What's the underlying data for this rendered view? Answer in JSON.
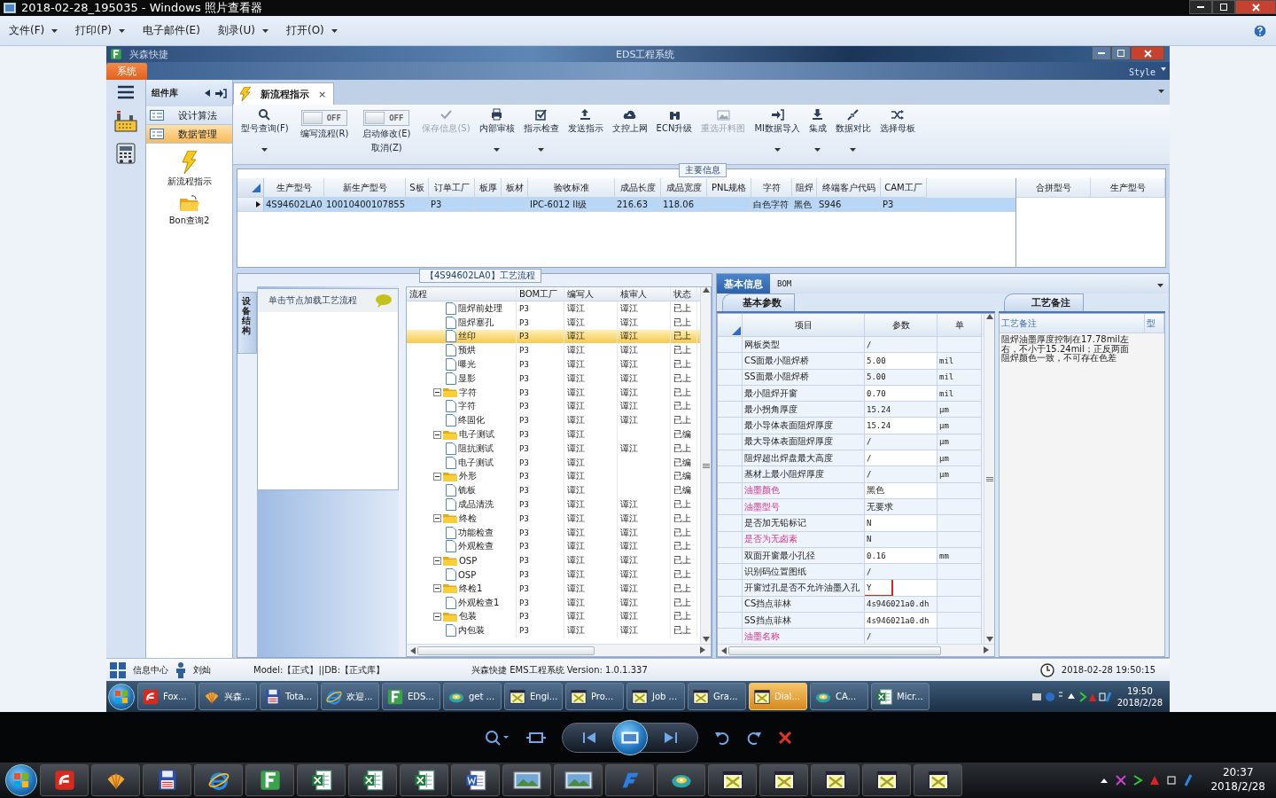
{
  "viewer": {
    "title": "2018-02-28_195035 - Windows 照片查看器",
    "menu": [
      {
        "label": "文件(F)",
        "dropdown": true
      },
      {
        "label": "打印(P)",
        "dropdown": true
      },
      {
        "label": "电子邮件(E)",
        "dropdown": false
      },
      {
        "label": "刻录(U)",
        "dropdown": true
      },
      {
        "label": "打开(O)",
        "dropdown": true
      }
    ]
  },
  "app": {
    "brand": "兴森快捷",
    "title": "EDS工程系统",
    "ribbon_tab": "系统",
    "style_label": "Style",
    "library": {
      "title": "组件库",
      "groups": [
        {
          "label": "设计算法",
          "selected": false
        },
        {
          "label": "数据管理",
          "selected": true
        }
      ],
      "tools": [
        {
          "label": "新流程指示",
          "kind": "bolt"
        },
        {
          "label": "Bon查询2",
          "kind": "folder"
        }
      ]
    },
    "doc_tab": {
      "label": "新流程指示",
      "close": "×"
    },
    "toolbar": [
      {
        "kind": "button",
        "label": "型号查询(F)",
        "dropdown": true,
        "disabled": false
      },
      {
        "kind": "toggle",
        "label": "编写流程(R)",
        "state": "OFF",
        "on": false
      },
      {
        "kind": "toggle",
        "label": "启动修改(E)",
        "label2": "取消(Z)",
        "state": "OFF",
        "on": false
      },
      {
        "kind": "button",
        "label": "保存信息(S)",
        "dropdown": false,
        "disabled": true
      },
      {
        "kind": "button",
        "label": "内部审核",
        "dropdown": true,
        "disabled": false
      },
      {
        "kind": "button",
        "label": "指示检查",
        "dropdown": true,
        "disabled": false
      },
      {
        "kind": "button",
        "label": "发送指示",
        "dropdown": false,
        "disabled": false
      },
      {
        "kind": "button",
        "label": "文控上网",
        "dropdown": false,
        "disabled": false
      },
      {
        "kind": "button",
        "label": "ECN升级",
        "dropdown": false,
        "disabled": false
      },
      {
        "kind": "button",
        "label": "重选开料图",
        "dropdown": false,
        "disabled": true
      },
      {
        "kind": "button",
        "label": "MI数据导入",
        "dropdown": true,
        "disabled": false
      },
      {
        "kind": "button",
        "label": "集成",
        "dropdown": true,
        "disabled": false
      },
      {
        "kind": "button",
        "label": "数据对比",
        "dropdown": true,
        "disabled": false
      },
      {
        "kind": "button",
        "label": "选择母板",
        "dropdown": false,
        "disabled": false
      }
    ],
    "main_info": {
      "title": "主要信息",
      "columns": [
        "生产型号",
        "新生产型号",
        "S板",
        "订单工厂",
        "板厚",
        "板材",
        "验收标准",
        "成品长度",
        "成品宽度",
        "PNL规格",
        "字符",
        "阻焊",
        "终端客户代码",
        "CAM工厂"
      ],
      "rows": [
        {
          "selected": true,
          "cells": [
            "4S94602LA0",
            "10010400107855",
            null,
            "P3",
            null,
            null,
            "IPC-6012 II级",
            "216.63",
            "118.06",
            null,
            "白色字符",
            "黑色",
            "S946",
            "P3"
          ]
        }
      ],
      "side_columns": [
        "合拼型号",
        "生产型号"
      ]
    },
    "flow": {
      "title": "【4S94602LA0】工艺流程",
      "side_tab": "设备结构",
      "hint": "单击节点加载工艺流程",
      "columns": [
        "流程",
        "BOM工厂",
        "编写人",
        "核审人",
        "状态"
      ],
      "rows": [
        {
          "kind": "continued",
          "children": [
            {
              "kind": "file",
              "label": "阻焊前处理",
              "factory": "P3",
              "author": "谭江",
              "reviewer": "谭江",
              "status": "已上",
              "selected": false
            },
            {
              "kind": "file",
              "label": "阻焊塞孔",
              "factory": "P3",
              "author": "谭江",
              "reviewer": "谭江",
              "status": "已上",
              "selected": false
            },
            {
              "kind": "file",
              "label": "丝印",
              "factory": "P3",
              "author": "谭江",
              "reviewer": "谭江",
              "status": "已上",
              "selected": true
            },
            {
              "kind": "file",
              "label": "预烘",
              "factory": "P3",
              "author": "谭江",
              "reviewer": "谭江",
              "status": "已上",
              "selected": false
            },
            {
              "kind": "file",
              "label": "曝光",
              "factory": "P3",
              "author": "谭江",
              "reviewer": "谭江",
              "status": "已上",
              "selected": false
            },
            {
              "kind": "file",
              "label": "显影",
              "factory": "P3",
              "author": "谭江",
              "reviewer": "谭江",
              "status": "已上",
              "selected": false
            }
          ]
        },
        {
          "kind": "folder",
          "label": "字符",
          "factory": "P3",
          "author": "谭江",
          "reviewer": "谭江",
          "status": "已上",
          "selected": false,
          "expanded": true,
          "children": [
            {
              "kind": "file",
              "label": "字符",
              "factory": "P3",
              "author": "谭江",
              "reviewer": "谭江",
              "status": "已上",
              "selected": false
            },
            {
              "kind": "file",
              "label": "终固化",
              "factory": "P3",
              "author": "谭江",
              "reviewer": "谭江",
              "status": "已上",
              "selected": false
            }
          ]
        },
        {
          "kind": "folder",
          "label": "电子测试",
          "factory": "P3",
          "author": "谭江",
          "status": "已编",
          "selected": false,
          "expanded": true,
          "children": [
            {
              "kind": "file",
              "label": "阻抗测试",
              "factory": "P3",
              "author": "谭江",
              "reviewer": "谭江",
              "status": "已上",
              "selected": false
            },
            {
              "kind": "file",
              "label": "电子测试",
              "factory": "P3",
              "author": "谭江",
              "status": "已编",
              "selected": false
            }
          ]
        },
        {
          "kind": "folder",
          "label": "外形",
          "factory": "P3",
          "author": "谭江",
          "status": "已编",
          "selected": false,
          "expanded": true,
          "children": [
            {
              "kind": "file",
              "label": "铣板",
              "factory": "P3",
              "author": "谭江",
              "status": "已编",
              "selected": false
            },
            {
              "kind": "file",
              "label": "成品清洗",
              "factory": "P3",
              "author": "谭江",
              "reviewer": "谭江",
              "status": "已上",
              "selected": false
            }
          ]
        },
        {
          "kind": "folder",
          "label": "终检",
          "factory": "P3",
          "author": "谭江",
          "reviewer": "谭江",
          "status": "已上",
          "selected": false,
          "expanded": true,
          "children": [
            {
              "kind": "file",
              "label": "功能检查",
              "factory": "P3",
              "author": "谭江",
              "reviewer": "谭江",
              "status": "已上",
              "selected": false
            },
            {
              "kind": "file",
              "label": "外观检查",
              "factory": "P3",
              "author": "谭江",
              "reviewer": "谭江",
              "status": "已上",
              "selected": false
            }
          ]
        },
        {
          "kind": "folder",
          "label": "OSP",
          "factory": "P3",
          "author": "谭江",
          "reviewer": "谭江",
          "status": "已上",
          "selected": false,
          "expanded": true,
          "children": [
            {
              "kind": "file",
              "label": "OSP",
              "factory": "P3",
              "author": "谭江",
              "reviewer": "谭江",
              "status": "已上",
              "selected": false
            }
          ]
        },
        {
          "kind": "folder",
          "label": "终检1",
          "factory": "P3",
          "author": "谭江",
          "reviewer": "谭江",
          "status": "已上",
          "selected": false,
          "expanded": true,
          "children": [
            {
              "kind": "file",
              "label": "外观检查1",
              "factory": "P3",
              "author": "谭江",
              "reviewer": "谭江",
              "status": "已上",
              "selected": false
            }
          ]
        },
        {
          "kind": "folder",
          "label": "包装",
          "factory": "P3",
          "author": "谭江",
          "reviewer": "谭江",
          "status": "已上",
          "selected": false,
          "expanded": true,
          "children": [
            {
              "kind": "file",
              "label": "内包装",
              "factory": "P3",
              "author": "谭江",
              "reviewer": "谭江",
              "status": "已上",
              "selected": false
            }
          ]
        }
      ]
    },
    "detail": {
      "tabs": [
        {
          "label": "基本信息",
          "selected": true
        },
        {
          "label": "BOM",
          "selected": false
        }
      ],
      "params": {
        "title": "基本参数",
        "columns": [
          "项目",
          "参数",
          "单"
        ],
        "rows": [
          {
            "item": "网板类型",
            "value": "/",
            "emphasis": false,
            "flagged": false
          },
          {
            "item": "CS面最小阻焊桥",
            "value": "5.00",
            "unit": "mil",
            "emphasis": false,
            "flagged": false
          },
          {
            "item": "SS面最小阻焊桥",
            "value": "5.00",
            "unit": "mil",
            "emphasis": false,
            "flagged": false
          },
          {
            "item": "最小阻焊开窗",
            "value": "0.70",
            "unit": "mil",
            "emphasis": false,
            "flagged": false
          },
          {
            "item": "最小拐角厚度",
            "value": "15.24",
            "unit": "μm",
            "emphasis": false,
            "flagged": false
          },
          {
            "item": "最小导体表面阻焊厚度",
            "value": "15.24",
            "unit": "μm",
            "emphasis": false,
            "flagged": false
          },
          {
            "item": "最大导体表面阻焊厚度",
            "value": "/",
            "unit": "μm",
            "emphasis": false,
            "flagged": false
          },
          {
            "item": "阻焊超出焊盘最大高度",
            "value": "/",
            "unit": "μm",
            "emphasis": false,
            "flagged": false
          },
          {
            "item": "基材上最小阻焊厚度",
            "value": "/",
            "unit": "μm",
            "emphasis": false,
            "flagged": false
          },
          {
            "item": "油墨颜色",
            "value": "黑色",
            "emphasis": true,
            "flagged": false
          },
          {
            "item": "油墨型号",
            "value": "无要求",
            "emphasis": true,
            "flagged": false
          },
          {
            "item": "是否加无铅标记",
            "value": "N",
            "emphasis": false,
            "flagged": false
          },
          {
            "item": "是否为无卤素",
            "value": "N",
            "emphasis": true,
            "flagged": false
          },
          {
            "item": "双面开窗最小孔径",
            "value": "0.16",
            "unit": "mm",
            "emphasis": false,
            "flagged": false
          },
          {
            "item": "识别码位置图纸",
            "value": "/",
            "emphasis": false,
            "flagged": false
          },
          {
            "item": "开窗过孔是否不允许油墨入孔",
            "value": "Y",
            "emphasis": false,
            "flagged": true
          },
          {
            "item": "CS挡点菲林",
            "value": "4s946021a0.dh",
            "emphasis": false,
            "flagged": false
          },
          {
            "item": "SS挡点菲林",
            "value": "4s946021a0.dh",
            "emphasis": false,
            "flagged": false
          },
          {
            "item": "油墨名称",
            "value": "/",
            "emphasis": true,
            "flagged": false
          }
        ]
      },
      "notes": {
        "title": "工艺备注",
        "columns": [
          "工艺备注",
          "型"
        ],
        "text": "阻焊油墨厚度控制在17.78mil左右，不小于15.24mil；正反两面阻焊颜色一致，不可存在色差"
      }
    },
    "status_bar": {
      "info": "信息中心",
      "user": "刘灿",
      "model": "Model:【正式】||DB:【正式库】",
      "product": "兴森快捷 EMS工程系统 Version: 1.0.1.337",
      "datetime": "2018-02-28 19:50:15"
    },
    "taskbar": {
      "items": [
        {
          "label": "Fox...",
          "kind": "foxit",
          "active": false
        },
        {
          "label": "兴森...",
          "kind": "shell",
          "active": false
        },
        {
          "label": "Tota...",
          "kind": "disk",
          "active": false
        },
        {
          "label": "欢迎...",
          "kind": "ie",
          "active": false
        },
        {
          "label": "EDS...",
          "kind": "f",
          "active": false
        },
        {
          "label": "get ...",
          "kind": "swirl",
          "active": false
        },
        {
          "label": "Engi...",
          "kind": "x",
          "active": false
        },
        {
          "label": "Pro...",
          "kind": "x",
          "active": false
        },
        {
          "label": "Job ...",
          "kind": "x",
          "active": false
        },
        {
          "label": "Gra...",
          "kind": "x",
          "active": false
        },
        {
          "label": "Dial...",
          "kind": "x",
          "active": true
        },
        {
          "label": "CA...",
          "kind": "swirl",
          "active": false
        },
        {
          "label": "Micr...",
          "kind": "excel",
          "active": false
        }
      ],
      "time": "19:50",
      "date": "2018/2/28"
    }
  },
  "taskbar": {
    "items": [
      {
        "kind": "foxit"
      },
      {
        "kind": "shell"
      },
      {
        "kind": "disk"
      },
      {
        "kind": "ie"
      },
      {
        "kind": "f"
      },
      {
        "kind": "excel"
      },
      {
        "kind": "excel"
      },
      {
        "kind": "excel"
      },
      {
        "kind": "word"
      },
      {
        "kind": "photo"
      },
      {
        "kind": "photo"
      },
      {
        "kind": "f2"
      },
      {
        "kind": "swirl"
      },
      {
        "kind": "x"
      },
      {
        "kind": "x"
      },
      {
        "kind": "x"
      },
      {
        "kind": "x"
      },
      {
        "kind": "x"
      }
    ],
    "time": "20:37",
    "date": "2018/2/28"
  }
}
